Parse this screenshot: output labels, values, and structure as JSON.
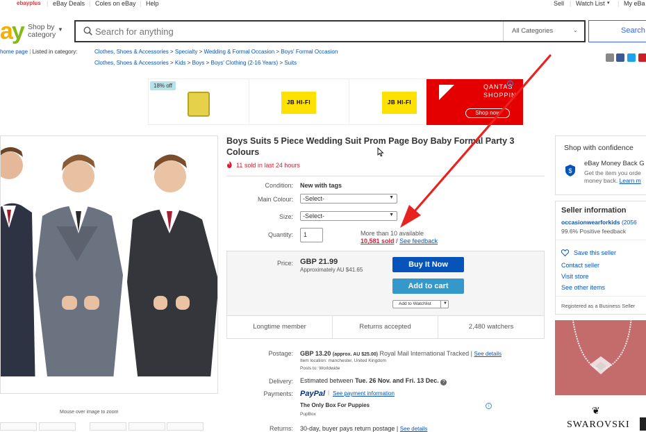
{
  "topnav": {
    "ebayplus": "ebayplus",
    "deals": "eBay Deals",
    "coles": "Coles on eBay",
    "help": "Help",
    "sell": "Sell",
    "watchlist": "Watch List",
    "myebay": "My eBa"
  },
  "header": {
    "logo": "ay",
    "shop_by_line1": "Shop by",
    "shop_by_line2": "category",
    "search_placeholder": "Search for anything",
    "category": "All Categories",
    "search_button": "Search"
  },
  "breadcrumbs": {
    "back": "home page",
    "listed_in": "Listed in category:",
    "path1": [
      "Clothes, Shoes & Accessories",
      "Specialty",
      "Wedding & Formal Occasion",
      "Boys' Formal Occasion"
    ],
    "path2": [
      "Clothes, Shoes & Accessories",
      "Kids",
      "Boys",
      "Boys' Clothing (2-16 Years)",
      "Suits"
    ],
    "separator": ">"
  },
  "ad": {
    "badge": "18% off",
    "jb_text": "JB HI-FI",
    "qantas_line1": "QANTAS",
    "qantas_line2": "SHOPPIN",
    "shop_now": "Shop now"
  },
  "image": {
    "mouseover": "Mouse over image to zoom"
  },
  "product": {
    "title": "Boys Suits 5 Piece Wedding Suit Prom Page Boy Baby Formal Party 3 Colours",
    "sold_24h": "11 sold in last 24 hours",
    "condition_label": "Condition:",
    "condition_value": "New with tags",
    "colour_label": "Main Colour:",
    "colour_value": "-Select-",
    "size_label": "Size:",
    "size_value": "-Select-",
    "qty_label": "Quantity:",
    "qty_value": "1",
    "available": "More than 10 available",
    "sold_link": "10,581 sold",
    "feedback_sep": "/",
    "feedback_link": "See feedback"
  },
  "pricebox": {
    "price_label": "Price:",
    "price": "GBP 21.99",
    "approx": "Approximately AU $41.65",
    "buy_now": "Buy It Now",
    "add_to_cart": "Add to cart",
    "watchlist": "Add to Watchlist",
    "feature1": "Longtime member",
    "feature2": "Returns accepted",
    "feature3": "2,480 watchers"
  },
  "shipping": {
    "postage_label": "Postage:",
    "postage_value": "GBP 13.20",
    "postage_approx": "(approx. AU $25.00)",
    "postage_service": "Royal Mail International Tracked |",
    "see_details": "See details",
    "item_location": "Item location:  manchester, United Kingdom",
    "posts_to": "Posts to:  Worldwide",
    "delivery_label": "Delivery:",
    "delivery_prefix": "Estimated between",
    "delivery_dates": "Tue. 26 Nov. and Fri. 13 Dec.",
    "payments_label": "Payments:",
    "paypal": "PayPal",
    "see_payment": "See payment information",
    "promo_title": "The Only Box For Puppies",
    "promo_brand": "PupBox",
    "returns_label": "Returns:",
    "returns_value": "30-day, buyer pays return postage |",
    "returns_details": "See details"
  },
  "confidence": {
    "heading": "Shop with confidence",
    "mbg_title": "eBay Money Back G",
    "mbg_text1": "Get the item you orde",
    "mbg_text2": "money back.",
    "learn_more": "Learn m"
  },
  "seller": {
    "heading": "Seller information",
    "name": "occasionwearforkids",
    "score": "(2056",
    "feedback": "99.6% Positive feedback",
    "save": "Save this seller",
    "contact": "Contact seller",
    "visit": "Visit store",
    "other": "See other items",
    "registered": "Registered as a Business Seller"
  },
  "sidead": {
    "brand": "SWAROVSKI"
  },
  "colors": {
    "link": "#0654ba",
    "buy_now": "#0654ba",
    "add_to_cart": "#3498ca",
    "red": "#dd1e31",
    "arrow": "#e8231f"
  }
}
